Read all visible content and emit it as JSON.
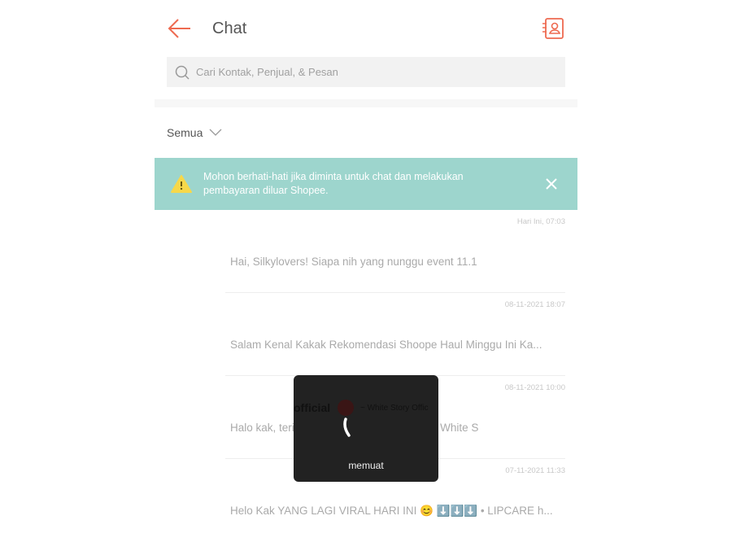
{
  "header": {
    "title": "Chat",
    "back_icon": "arrow-left-icon",
    "contacts_icon": "contact-book-icon",
    "accent": "#ee6a50"
  },
  "search": {
    "placeholder": "Cari Kontak, Penjual, & Pesan"
  },
  "filter": {
    "selected": "Semua"
  },
  "banner": {
    "text": "Mohon berhati-hati jika diminta untuk chat dan melakukan pembayaran diluar Shopee.",
    "color": "#9dd5cd"
  },
  "chats": [
    {
      "time": "Hari Ini, 07:03",
      "message": "Hai, Silkylovers! Siapa nih yang nunggu event 11.1"
    },
    {
      "time": "08-11-2021 18:07",
      "message": "Salam Kenal Kakak   Rekomendasi Shoope Haul Minggu Ini Ka..."
    },
    {
      "time": "08-11-2021 10:00",
      "message": "Halo kak, terima kasih sudah berbelanja di White S"
    },
    {
      "time": "07-11-2021 11:33",
      "message": "Helo Kak   YANG LAGI VIRAL HARI INI 😊 ⬇️⬇️⬇️  • LIPCARE h..."
    }
  ],
  "loading": {
    "label": "memuat",
    "name_partial": "official",
    "sub_partial": "~ White Story Offic"
  }
}
